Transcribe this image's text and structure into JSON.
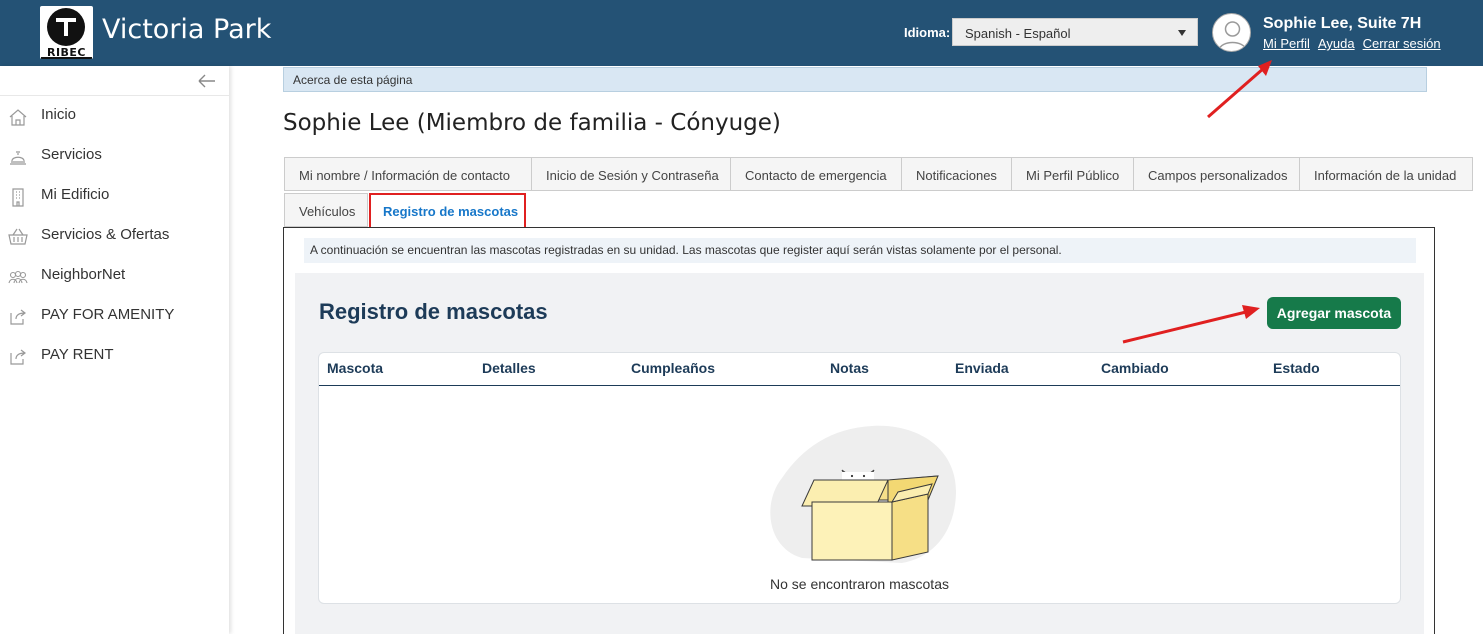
{
  "header": {
    "app_title": "Victoria Park",
    "logo_text": "RIBEC",
    "language_label": "Idioma:",
    "language_value": "Spanish - Español",
    "user_name": "Sophie Lee, Suite 7H",
    "links": [
      "Mi Perfil",
      "Ayuda",
      "Cerrar sesión"
    ]
  },
  "sidebar": {
    "collapse_icon": "arrow-left-icon",
    "items": [
      {
        "label": "Inicio",
        "icon": "home-icon"
      },
      {
        "label": "Servicios",
        "icon": "concierge-bell-icon"
      },
      {
        "label": "Mi Edificio",
        "icon": "building-icon"
      },
      {
        "label": "Servicios & Ofertas",
        "icon": "basket-icon"
      },
      {
        "label": "NeighborNet",
        "icon": "people-icon"
      },
      {
        "label": "PAY FOR AMENITY",
        "icon": "external-link-icon"
      },
      {
        "label": "PAY RENT",
        "icon": "external-link-icon"
      }
    ]
  },
  "main": {
    "about_label": "Acerca de esta página",
    "page_title": "Sophie Lee (Miembro de familia - Cónyuge)",
    "tabs": [
      {
        "label": "Mi nombre / Información de contacto",
        "active": false
      },
      {
        "label": "Inicio de Sesión y Contraseña",
        "active": false
      },
      {
        "label": "Contacto de emergencia",
        "active": false
      },
      {
        "label": "Notificaciones",
        "active": false
      },
      {
        "label": "Mi Perfil Público",
        "active": false
      },
      {
        "label": "Campos personalizados",
        "active": false
      },
      {
        "label": "Información de la unidad",
        "active": false
      },
      {
        "label": "Vehículos",
        "active": false
      },
      {
        "label": "Registro de mascotas",
        "active": true
      }
    ],
    "info_text": "A continuación se encuentran las mascotas registradas en su unidad. Las mascotas que register aquí serán vistas solamente por el personal.",
    "pets": {
      "heading": "Registro de mascotas",
      "add_button": "Agregar mascota",
      "columns": [
        "Mascota",
        "Detalles",
        "Cumpleaños",
        "Notas",
        "Enviada",
        "Cambiado",
        "Estado"
      ],
      "rows": [],
      "empty_text": "No se encontraron mascotas"
    }
  },
  "colors": {
    "header_bg": "#245275",
    "accent_green": "#167a4a",
    "highlight_red": "#e02020",
    "heading_navy": "#1d3b58"
  }
}
